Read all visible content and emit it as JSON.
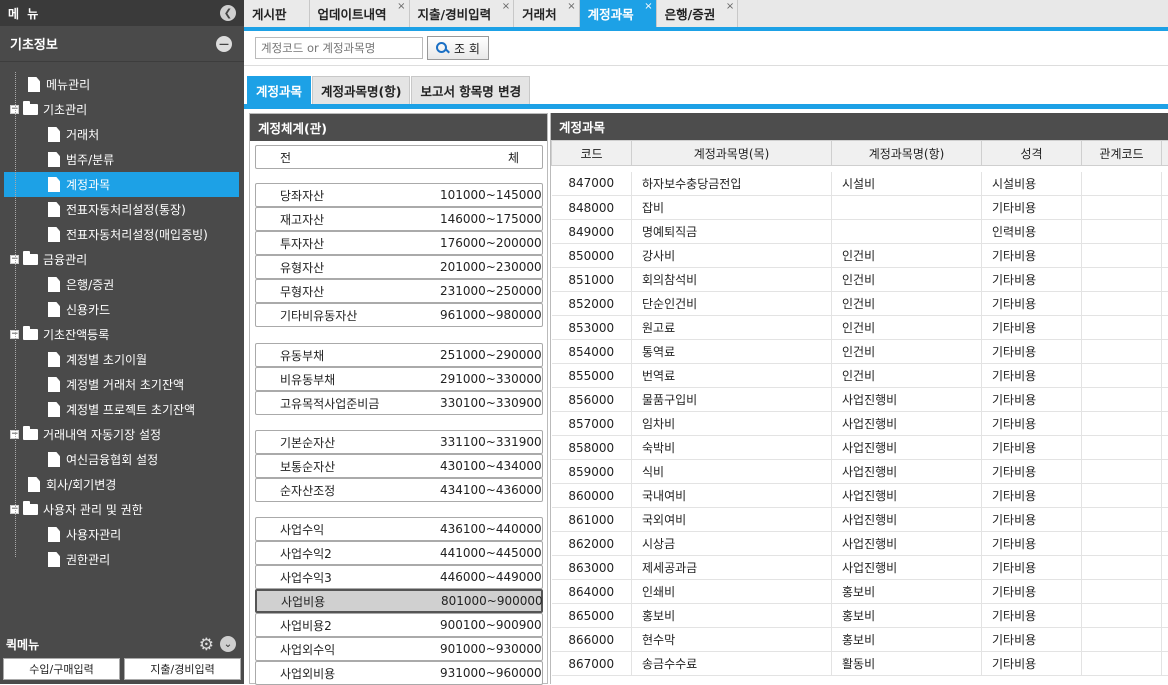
{
  "sidebar": {
    "menu_title": "메 뉴",
    "section_title": "기초정보",
    "quick_title": "퀵메뉴",
    "quick_buttons": [
      "수입/구매입력",
      "지출/경비입력"
    ],
    "tree": [
      {
        "label": "메뉴관리",
        "type": "doc"
      },
      {
        "label": "기초관리",
        "type": "folder"
      },
      {
        "label": "거래처",
        "type": "doc"
      },
      {
        "label": "범주/분류",
        "type": "doc"
      },
      {
        "label": "계정과목",
        "type": "doc"
      },
      {
        "label": "전표자동처리설정(통장)",
        "type": "doc"
      },
      {
        "label": "전표자동처리설정(매입증빙)",
        "type": "doc"
      },
      {
        "label": "금융관리",
        "type": "folder"
      },
      {
        "label": "은행/증권",
        "type": "doc"
      },
      {
        "label": "신용카드",
        "type": "doc"
      },
      {
        "label": "기초잔액등록",
        "type": "folder"
      },
      {
        "label": "계정별 초기이월",
        "type": "doc"
      },
      {
        "label": "계정별 거래처 초기잔액",
        "type": "doc"
      },
      {
        "label": "계정별 프로젝트 초기잔액",
        "type": "doc"
      },
      {
        "label": "거래내역 자동기장 설정",
        "type": "folder"
      },
      {
        "label": "여신금융협회 설정",
        "type": "doc"
      },
      {
        "label": "회사/회기변경",
        "type": "doc"
      },
      {
        "label": "사용자 관리 및 권한",
        "type": "folder"
      },
      {
        "label": "사용자관리",
        "type": "doc"
      },
      {
        "label": "권한관리",
        "type": "doc"
      }
    ]
  },
  "tabs": [
    "게시판",
    "업데이트내역",
    "지출/경비입력",
    "거래처",
    "계정과목",
    "은행/증권"
  ],
  "active_tab": "계정과목",
  "search": {
    "placeholder": "계정코드 or 계정과목명",
    "button": "조 회"
  },
  "subtabs": [
    "계정과목",
    "계정과목명(항)",
    "보고서 항목명 변경"
  ],
  "left_panel": {
    "title": "계정체계(관)",
    "all_label_left": "전",
    "all_label_right": "체",
    "groups": [
      {
        "name": "당좌자산",
        "range": "101000~145000"
      },
      {
        "name": "재고자산",
        "range": "146000~175000"
      },
      {
        "name": "투자자산",
        "range": "176000~200000"
      },
      {
        "name": "유형자산",
        "range": "201000~230000"
      },
      {
        "name": "무형자산",
        "range": "231000~250000"
      },
      {
        "name": "기타비유동자산",
        "range": "961000~980000"
      },
      {
        "name": "유동부채",
        "range": "251000~290000"
      },
      {
        "name": "비유동부채",
        "range": "291000~330000"
      },
      {
        "name": "고유목적사업준비금",
        "range": "330100~330900"
      },
      {
        "name": "기본순자산",
        "range": "331100~331900"
      },
      {
        "name": "보통순자산",
        "range": "430100~434000"
      },
      {
        "name": "순자산조정",
        "range": "434100~436000"
      },
      {
        "name": "사업수익",
        "range": "436100~440000"
      },
      {
        "name": "사업수익2",
        "range": "441000~445000"
      },
      {
        "name": "사업수익3",
        "range": "446000~449000"
      },
      {
        "name": "사업비용",
        "range": "801000~900000"
      },
      {
        "name": "사업비용2",
        "range": "900100~900900"
      },
      {
        "name": "사업외수익",
        "range": "901000~930000"
      },
      {
        "name": "사업외비용",
        "range": "931000~960000"
      }
    ]
  },
  "right_panel": {
    "title": "계정과목",
    "columns": [
      "코드",
      "계정과목명(목)",
      "계정과목명(항)",
      "성격",
      "관계코드"
    ],
    "rows": [
      [
        "847000",
        "하자보수충당금전입",
        "시설비",
        "시설비용",
        ""
      ],
      [
        "848000",
        "잡비",
        "",
        "기타비용",
        ""
      ],
      [
        "849000",
        "명예퇴직금",
        "",
        "인력비용",
        ""
      ],
      [
        "850000",
        "강사비",
        "인건비",
        "기타비용",
        ""
      ],
      [
        "851000",
        "회의참석비",
        "인건비",
        "기타비용",
        ""
      ],
      [
        "852000",
        "단순인건비",
        "인건비",
        "기타비용",
        ""
      ],
      [
        "853000",
        "원고료",
        "인건비",
        "기타비용",
        ""
      ],
      [
        "854000",
        "통역료",
        "인건비",
        "기타비용",
        ""
      ],
      [
        "855000",
        "번역료",
        "인건비",
        "기타비용",
        ""
      ],
      [
        "856000",
        "물품구입비",
        "사업진행비",
        "기타비용",
        ""
      ],
      [
        "857000",
        "임차비",
        "사업진행비",
        "기타비용",
        ""
      ],
      [
        "858000",
        "숙박비",
        "사업진행비",
        "기타비용",
        ""
      ],
      [
        "859000",
        "식비",
        "사업진행비",
        "기타비용",
        ""
      ],
      [
        "860000",
        "국내여비",
        "사업진행비",
        "기타비용",
        ""
      ],
      [
        "861000",
        "국외여비",
        "사업진행비",
        "기타비용",
        ""
      ],
      [
        "862000",
        "시상금",
        "사업진행비",
        "기타비용",
        ""
      ],
      [
        "863000",
        "제세공과금",
        "사업진행비",
        "기타비용",
        ""
      ],
      [
        "864000",
        "인쇄비",
        "홍보비",
        "기타비용",
        ""
      ],
      [
        "865000",
        "홍보비",
        "홍보비",
        "기타비용",
        ""
      ],
      [
        "866000",
        "현수막",
        "홍보비",
        "기타비용",
        ""
      ],
      [
        "867000",
        "송금수수료",
        "활동비",
        "기타비용",
        ""
      ]
    ]
  }
}
